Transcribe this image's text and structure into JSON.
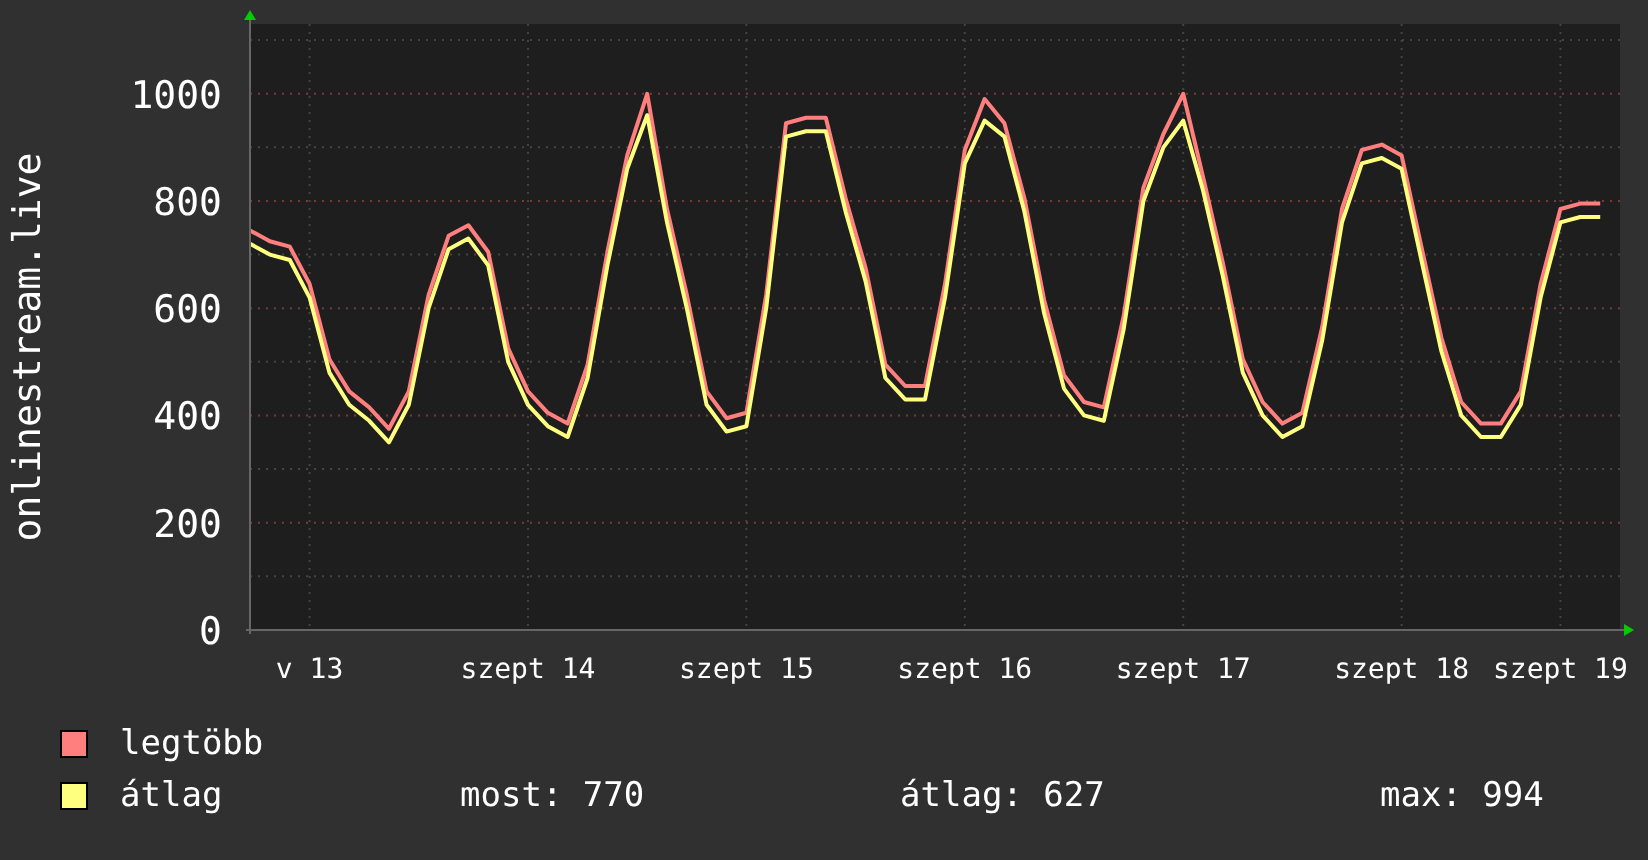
{
  "chart": {
    "chart_data": {
      "type": "line",
      "ylabel": "onlinestream.live",
      "categories": [
        null,
        null,
        null,
        "v 13",
        null,
        null,
        null,
        null,
        null,
        null,
        null,
        null,
        null,
        null,
        "szept 14",
        null,
        null,
        null,
        null,
        null,
        null,
        null,
        null,
        null,
        null,
        "szept 15",
        null,
        null,
        null,
        null,
        null,
        null,
        null,
        null,
        null,
        null,
        "szept 16",
        null,
        null,
        null,
        null,
        null,
        null,
        null,
        null,
        null,
        null,
        "szept 17",
        null,
        null,
        null,
        null,
        null,
        null,
        null,
        null,
        null,
        null,
        "szept 18",
        null,
        null,
        null,
        null,
        null,
        null,
        null,
        "szept 19",
        null,
        null
      ],
      "series": [
        {
          "name": "legtöbb",
          "color": "#ff7f7f",
          "values": [
            745,
            725,
            715,
            645,
            505,
            445,
            415,
            375,
            445,
            625,
            735,
            755,
            705,
            525,
            445,
            405,
            385,
            495,
            705,
            885,
            1000,
            785,
            625,
            445,
            395,
            405,
            625,
            945,
            955,
            955,
            805,
            675,
            495,
            455,
            455,
            645,
            895,
            990,
            945,
            805,
            615,
            475,
            425,
            415,
            585,
            825,
            925,
            1000,
            845,
            685,
            505,
            425,
            385,
            405,
            565,
            785,
            895,
            905,
            885,
            715,
            545,
            425,
            385,
            385,
            445,
            645,
            785,
            795,
            795
          ]
        },
        {
          "name": "átlag",
          "color": "#ffff7f",
          "values": [
            720,
            700,
            690,
            620,
            480,
            420,
            390,
            350,
            420,
            600,
            710,
            730,
            680,
            500,
            420,
            380,
            360,
            470,
            680,
            860,
            960,
            760,
            600,
            420,
            370,
            380,
            600,
            920,
            930,
            930,
            780,
            650,
            470,
            430,
            430,
            620,
            870,
            950,
            920,
            780,
            590,
            450,
            400,
            390,
            560,
            800,
            900,
            950,
            820,
            660,
            480,
            400,
            360,
            380,
            540,
            760,
            870,
            880,
            860,
            690,
            520,
            400,
            360,
            360,
            420,
            620,
            760,
            770,
            770
          ]
        }
      ],
      "ylim": [
        0,
        1130
      ],
      "grid": true,
      "yticks": [
        0,
        200,
        400,
        600,
        800,
        1000
      ]
    }
  },
  "stats": [
    "most: 770",
    "átlag: 627",
    "max: 994"
  ]
}
